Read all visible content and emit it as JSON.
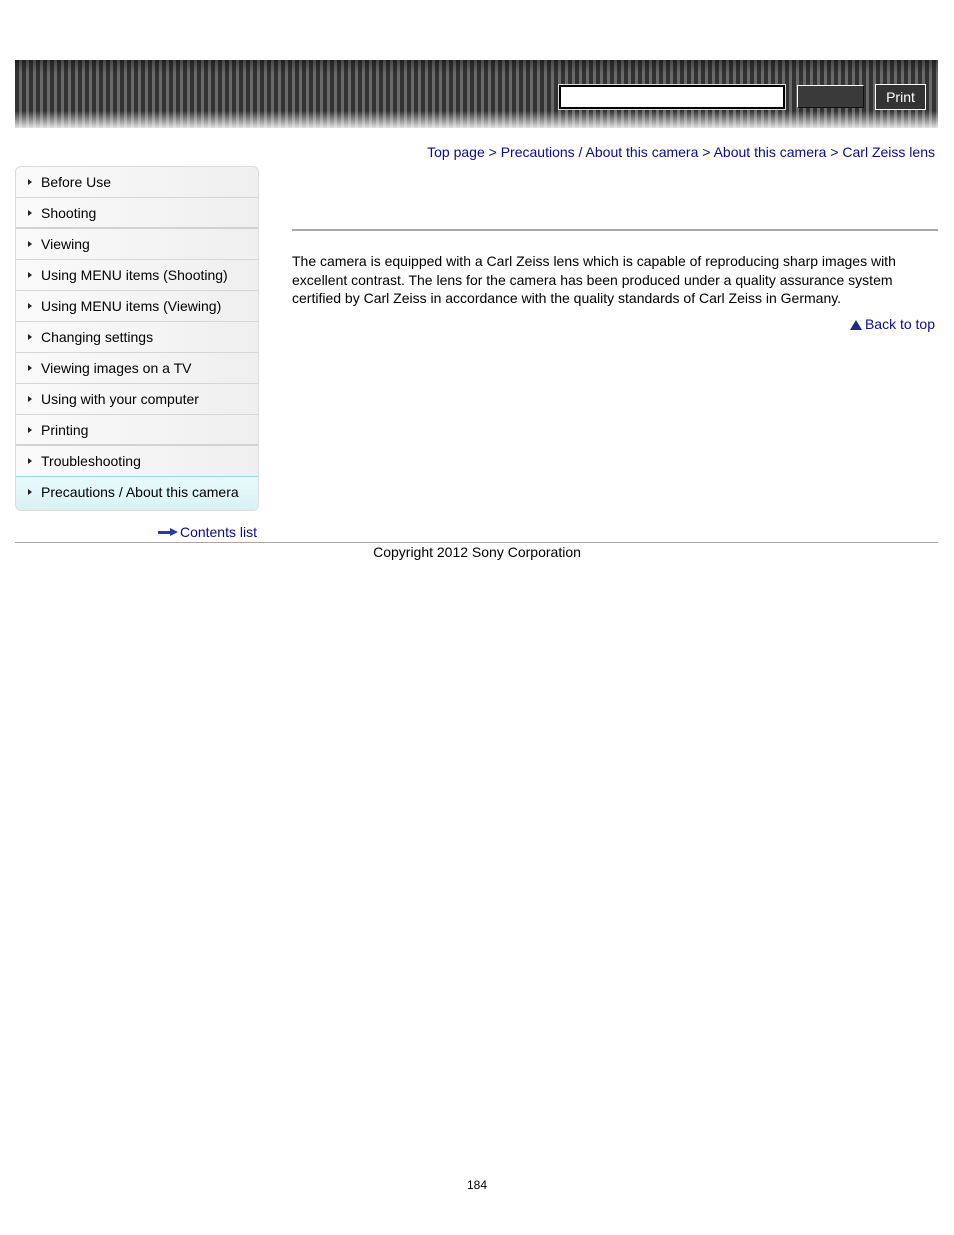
{
  "header": {
    "search": {
      "value": "",
      "placeholder": ""
    },
    "search_button_label": "",
    "print_label": "Print"
  },
  "breadcrumb": {
    "items": [
      "Top page",
      "Precautions / About this camera",
      "About this camera",
      "Carl Zeiss lens"
    ],
    "separator": ">"
  },
  "sidebar": {
    "items": [
      {
        "label": "Before Use"
      },
      {
        "label": "Shooting"
      },
      {
        "label": "Viewing"
      },
      {
        "label": "Using MENU items (Shooting)"
      },
      {
        "label": "Using MENU items (Viewing)"
      },
      {
        "label": "Changing settings"
      },
      {
        "label": "Viewing images on a TV"
      },
      {
        "label": "Using with your computer"
      },
      {
        "label": "Printing"
      },
      {
        "label": "Troubleshooting"
      },
      {
        "label": "Precautions / About this camera",
        "active": true
      }
    ],
    "contents_list_label": "Contents list"
  },
  "main": {
    "title": "",
    "body": "The camera is equipped with a Carl Zeiss lens which is capable of reproducing sharp images with excellent contrast. The lens for the camera has been produced under a quality assurance system certified by Carl Zeiss in accordance with the quality standards of Carl Zeiss in Germany.",
    "back_to_top_label": "Back to top"
  },
  "footer": {
    "copyright": "Copyright 2012 Sony Corporation",
    "page_number": "184"
  },
  "colors": {
    "link": "#0d0d8a",
    "active_nav_bg": "#e2f6f9",
    "active_nav_border": "#8fdbe8"
  }
}
